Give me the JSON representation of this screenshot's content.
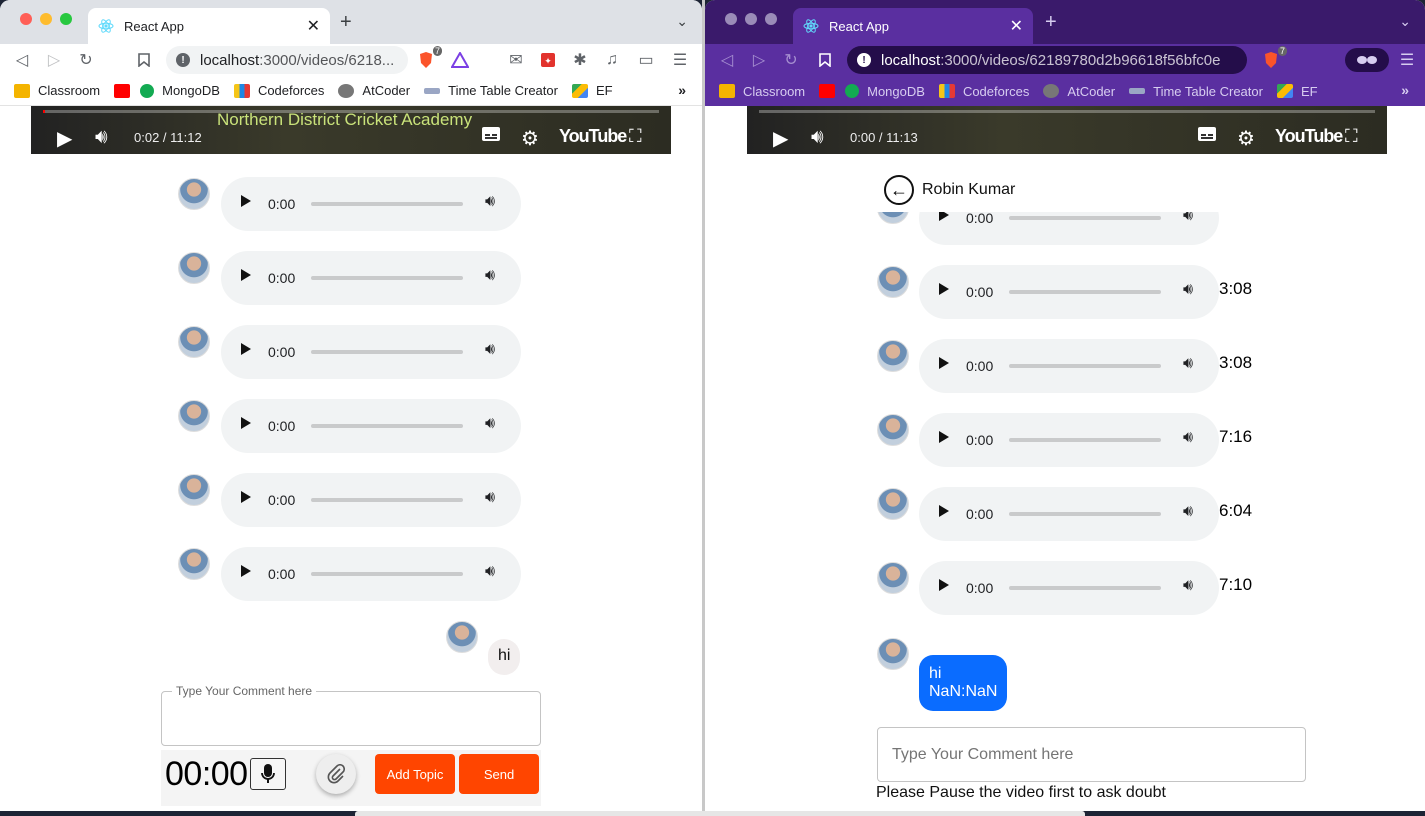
{
  "left_window": {
    "tab_title": "React App",
    "url_host": "localhost",
    "url_path": ":3000/videos/6218...",
    "brave_badge": "7",
    "bookmarks": [
      "Classroom",
      "MongoDB",
      "Codeforces",
      "AtCoder",
      "Time Table Creator",
      "EF"
    ],
    "video": {
      "overlay_title": "Northern District Cricket Academy",
      "time": "0:02 / 11:12",
      "logo": "YouTube",
      "progress": 0.003
    },
    "audio_messages": [
      {
        "time": "0:00"
      },
      {
        "time": "0:00"
      },
      {
        "time": "0:00"
      },
      {
        "time": "0:00"
      },
      {
        "time": "0:00"
      },
      {
        "time": "0:00"
      }
    ],
    "text_message": "hi",
    "comment_label": "Type Your Comment here",
    "timer": "00:00",
    "add_topic_label": "Add Topic",
    "send_label": "Send"
  },
  "right_window": {
    "tab_title": "React App",
    "url_host": "localhost",
    "url_path": ":3000/videos/62189780d2b96618f56bfc0e",
    "brave_badge": "7",
    "bookmarks": [
      "Classroom",
      "MongoDB",
      "Codeforces",
      "AtCoder",
      "Time Table Creator",
      "EF"
    ],
    "video": {
      "time": "0:00 / 11:13",
      "logo": "YouTube",
      "progress": 0.0
    },
    "chat_header": "Robin Kumar",
    "audio_messages": [
      {
        "time": "0:00",
        "duration": ""
      },
      {
        "time": "0:00",
        "duration": "3:08"
      },
      {
        "time": "0:00",
        "duration": "3:08"
      },
      {
        "time": "0:00",
        "duration": "7:16"
      },
      {
        "time": "0:00",
        "duration": "6:04"
      },
      {
        "time": "0:00",
        "duration": "7:10"
      }
    ],
    "text_message": {
      "text": "hi",
      "timestamp": "NaN:NaN"
    },
    "comment_placeholder": "Type Your Comment here",
    "hint": "Please Pause the video first to ask doubt"
  },
  "colors": {
    "send_button": "#ff4500",
    "message_bubble_blue": "#0a6cff",
    "left_tabstrip": "#dee1e6",
    "right_tabstrip": "#3a1a6b"
  }
}
